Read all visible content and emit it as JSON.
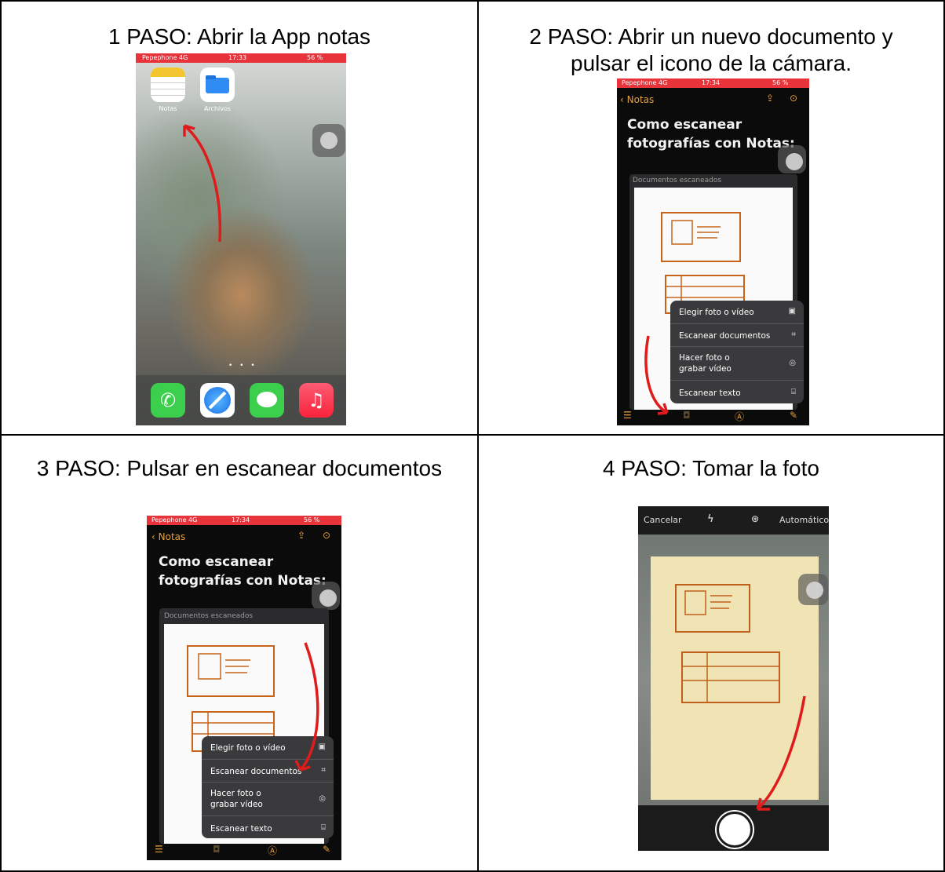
{
  "steps": [
    {
      "title": "1 PASO: Abrir la App notas"
    },
    {
      "title_line1": "2 PASO: Abrir un nuevo documento y",
      "title_line2": "pulsar el icono de la cámara."
    },
    {
      "title": "3 PASO: Pulsar en escanear documentos"
    },
    {
      "title": "4 PASO: Tomar la foto"
    }
  ],
  "status": {
    "carrier": "Pepephone  4G",
    "time1": "17:33",
    "time2": "17:34",
    "battery": "56 %"
  },
  "home": {
    "apps": [
      {
        "label": "Notas",
        "icon": "notes-icon"
      },
      {
        "label": "Archivos",
        "icon": "files-icon"
      }
    ],
    "dock": [
      "phone-icon",
      "safari-icon",
      "messages-icon",
      "music-icon"
    ]
  },
  "notes": {
    "back_label": "Notas",
    "title_line1": "Como escanear",
    "title_line2": "fotografías con Notas:",
    "scanned_label": "Documentos escaneados",
    "menu": [
      {
        "label": "Elegir foto o vídeo",
        "icon": "photo-icon"
      },
      {
        "label": "Escanear documentos",
        "icon": "scan-icon"
      },
      {
        "label_line1": "Hacer foto o",
        "label_line2": "grabar vídeo",
        "icon": "camera-icon"
      },
      {
        "label": "Escanear texto",
        "icon": "text-scan-icon"
      }
    ]
  },
  "camera": {
    "cancel": "Cancelar",
    "mode": "Automático"
  },
  "colors": {
    "notes_accent": "#e9a23b",
    "arrow": "#e01b1b",
    "status_red": "#e8333a"
  }
}
